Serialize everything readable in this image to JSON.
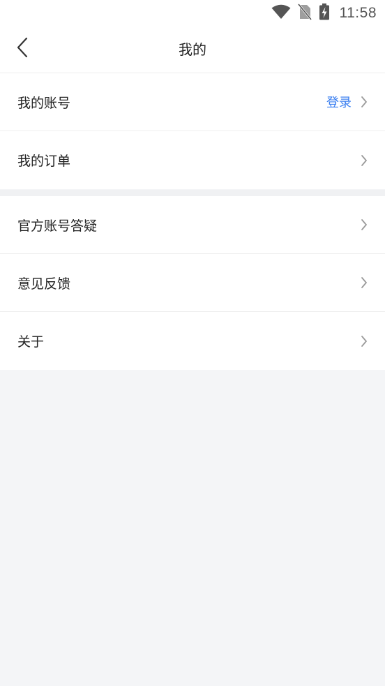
{
  "status_bar": {
    "time": "11:58",
    "icons": [
      "wifi-icon",
      "no-sim-icon",
      "battery-charging-icon"
    ]
  },
  "header": {
    "title": "我的",
    "back_icon": "chevron-left-icon"
  },
  "groups": [
    {
      "items": [
        {
          "label": "我的账号",
          "value": "登录"
        },
        {
          "label": "我的订单"
        }
      ]
    },
    {
      "items": [
        {
          "label": "官方账号答疑"
        },
        {
          "label": "意见反馈"
        },
        {
          "label": "关于"
        }
      ]
    }
  ],
  "colors": {
    "accent": "#3b7ff0",
    "background": "#f4f5f7",
    "surface": "#ffffff",
    "text": "#222222",
    "chevron": "#9a9a9a"
  }
}
